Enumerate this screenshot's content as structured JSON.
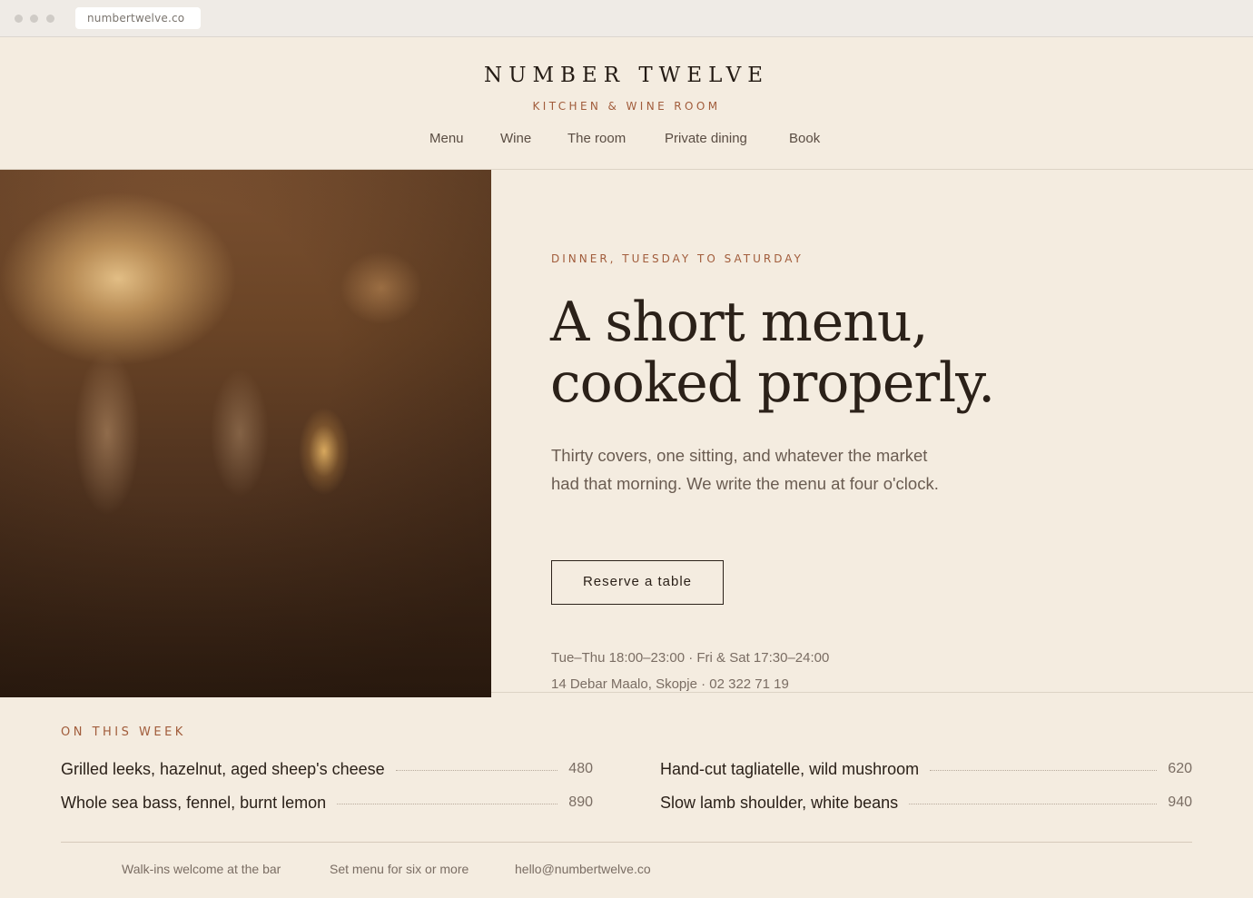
{
  "browser": {
    "url": "numbertwelve.co"
  },
  "header": {
    "brand": "NUMBER TWELVE",
    "tagline": "KITCHEN & WINE ROOM",
    "nav": [
      "Menu",
      "Wine",
      "The room",
      "Private dining",
      "Book"
    ]
  },
  "hero": {
    "eyebrow": "DINNER, TUESDAY TO SATURDAY",
    "headline_line1": "A short menu,",
    "headline_line2": "cooked properly.",
    "intro": "Thirty covers, one sitting, and whatever the market had that morning. We write the menu at four o'clock.",
    "cta": "Reserve a table",
    "hours": "Tue–Thu 18:00–23:00 · Fri & Sat 17:30–24:00",
    "address": "14 Debar Maalo, Skopje · 02 322 71 19"
  },
  "this_week": {
    "label": "ON THIS WEEK",
    "dishes": [
      {
        "name": "Grilled leeks, hazelnut, aged sheep's cheese",
        "price": "480"
      },
      {
        "name": "Whole sea bass, fennel, burnt lemon",
        "price": "890"
      },
      {
        "name": "Hand-cut tagliatelle, wild mushroom",
        "price": "620"
      },
      {
        "name": "Slow lamb shoulder, white beans",
        "price": "940"
      }
    ]
  },
  "footer": {
    "notes": [
      "Walk-ins welcome at the bar",
      "Set menu for six or more",
      "hello@numbertwelve.co"
    ]
  },
  "colors": {
    "background": "#f4ece0",
    "accent": "#a15c3b",
    "ink": "#2b2119"
  }
}
